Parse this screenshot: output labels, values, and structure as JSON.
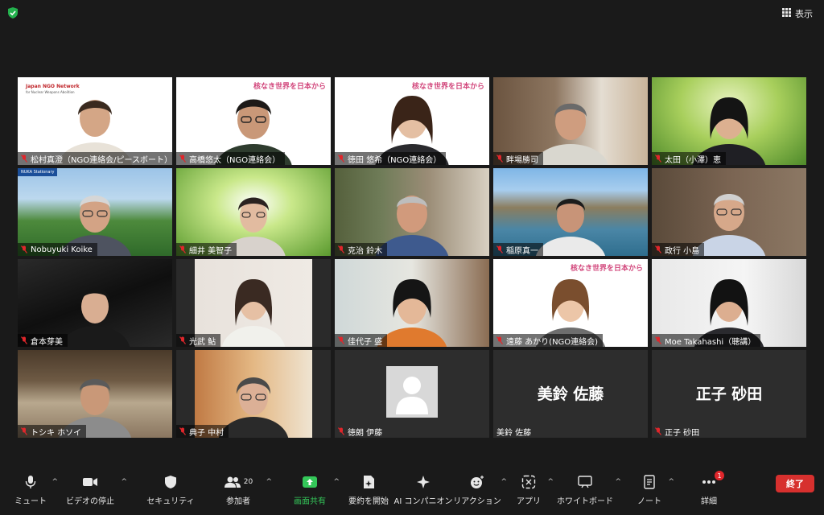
{
  "view_button": {
    "label": "表示"
  },
  "participants": [
    {
      "name": "松村真澄（NGO連絡会/ピースボート）"
    },
    {
      "name": "高橋悠太（NGO連絡会）"
    },
    {
      "name": "徳田 悠希（NGO連絡会）"
    },
    {
      "name": "畔場勝司"
    },
    {
      "name": "太田（小澤）恵"
    },
    {
      "name": "Nobuyuki Koike"
    },
    {
      "name": "細井 美智子"
    },
    {
      "name": "克治 鈴木"
    },
    {
      "name": "稲原真一"
    },
    {
      "name": "政行 小島"
    },
    {
      "name": "倉本芽美"
    },
    {
      "name": "光武 鮎"
    },
    {
      "name": "佳代子 盛"
    },
    {
      "name": "遠藤 あかり(NGO連絡会)"
    },
    {
      "name": "Moe Takahashi（聴講）"
    },
    {
      "name": "トシキ ホソイ"
    },
    {
      "name": "典子 中村"
    },
    {
      "name": "徳朗 伊藤"
    },
    {
      "name": "美鈴 佐藤",
      "display": "美鈴 佐藤"
    },
    {
      "name": "正子 砂田",
      "display": "正子 砂田"
    }
  ],
  "banners": {
    "japan_ngo": "Japan NGO Network",
    "japan_ngo_sub": "for Nuclear Weapons Abolition",
    "slogan": "核なき世界を日本から",
    "nuku": "NUKA Stationary"
  },
  "toolbar": {
    "mute": "ミュート",
    "video": "ビデオの停止",
    "security": "セキュリティ",
    "participants": "参加者",
    "participant_count": "20",
    "share": "画面共有",
    "summary": "要約を開始",
    "ai": "AI コンパニオン",
    "reaction": "リアクション",
    "apps": "アプリ",
    "whiteboard": "ホワイトボード",
    "notes": "ノート",
    "more": "詳細",
    "more_badge": "1",
    "end": "終了"
  },
  "colors": {
    "active_border": "#dfe35a",
    "share_green": "#34c759",
    "end_red": "#d7302e",
    "mute_red": "#e0262b"
  }
}
